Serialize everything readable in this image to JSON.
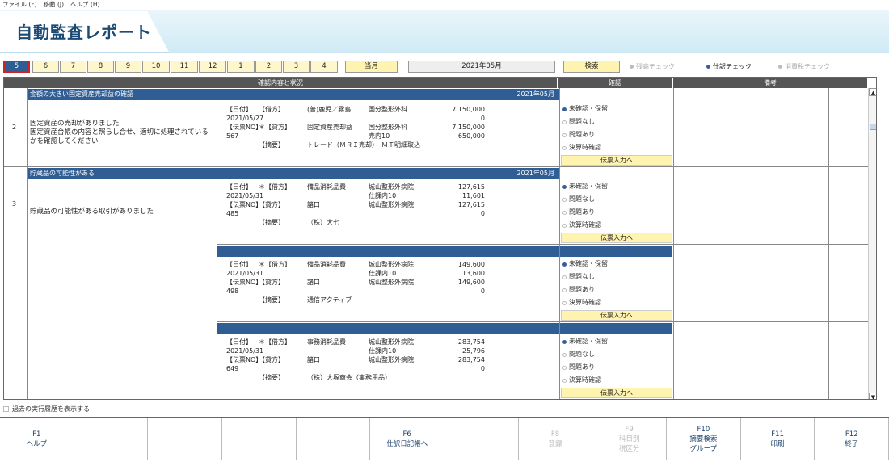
{
  "menu": [
    "ファイル (F)",
    "移動 (J)",
    "ヘルプ (H)"
  ],
  "title": "自動監査レポート",
  "months": [
    "5",
    "6",
    "7",
    "8",
    "9",
    "10",
    "11",
    "12",
    "1",
    "2",
    "3",
    "4"
  ],
  "current_month_label": "当月",
  "year_month": "2021年05月",
  "search_label": "検索",
  "radios": [
    {
      "label": "残高チェック",
      "selected": false
    },
    {
      "label": "仕訳チェック",
      "selected": true
    },
    {
      "label": "消費税チェック",
      "selected": false
    }
  ],
  "headers": {
    "content": "確認内容と状況",
    "confirm": "確認",
    "note": "備考"
  },
  "check_options": [
    "未確認・保留",
    "問題なし",
    "問題あり",
    "決算時確認"
  ],
  "slip_label": "伝票入力へ",
  "sections": [
    {
      "num": "2",
      "title": "金額の大きい固定資産売却益の確認",
      "ym": "2021年05月",
      "desc": "固定資産の売却がありました\n固定資産台帳の内容と照らし合せ、適切に処理されているかを確認してください",
      "entries": [
        {
          "lines": [
            [
              "【日付】",
              "【借方】",
              "(普)鹿児／霧島",
              "国分整形外科",
              "7,150,000"
            ],
            [
              "2021/05/27",
              "",
              "",
              "",
              "0"
            ],
            [
              "【伝票NO】",
              "＊【貸方】",
              "固定資産売却益",
              "国分整形外科",
              "7,150,000"
            ],
            [
              "567",
              "",
              "",
              "売内10",
              "650,000"
            ],
            [
              "",
              "【摘要】",
              "トレード（ＭＲＩ売却）　ＭＴ明細取込",
              "",
              ""
            ]
          ]
        }
      ]
    },
    {
      "num": "3",
      "title": "貯蔵品の可能性がある",
      "ym": "2021年05月",
      "desc": "貯蔵品の可能性がある取引がありました",
      "entries": [
        {
          "lines": [
            [
              "【日付】",
              "＊【借方】",
              "備品消耗品費",
              "城山整形外病院",
              "127,615"
            ],
            [
              "2021/05/31",
              "",
              "",
              "仕課内10",
              "11,601"
            ],
            [
              "【伝票NO】",
              "【貸方】",
              "諸口",
              "城山整形外病院",
              "127,615"
            ],
            [
              "485",
              "",
              "",
              "",
              "0"
            ],
            [
              "",
              "【摘要】",
              "（株）大七",
              "",
              ""
            ]
          ]
        },
        {
          "lines": [
            [
              "【日付】",
              "＊【借方】",
              "備品消耗品費",
              "城山整形外病院",
              "149,600"
            ],
            [
              "2021/05/31",
              "",
              "",
              "仕課内10",
              "13,600"
            ],
            [
              "【伝票NO】",
              "【貸方】",
              "諸口",
              "城山整形外病院",
              "149,600"
            ],
            [
              "498",
              "",
              "",
              "",
              "0"
            ],
            [
              "",
              "【摘要】",
              "通信アクティブ",
              "",
              ""
            ]
          ]
        },
        {
          "lines": [
            [
              "【日付】",
              "＊【借方】",
              "事務消耗品費",
              "城山整形外病院",
              "283,754"
            ],
            [
              "2021/05/31",
              "",
              "",
              "仕課内10",
              "25,796"
            ],
            [
              "【伝票NO】",
              "【貸方】",
              "諸口",
              "城山整形外病院",
              "283,754"
            ],
            [
              "649",
              "",
              "",
              "",
              "0"
            ],
            [
              "",
              "【摘要】",
              "（株）大塚商会（事務用品）",
              "",
              ""
            ]
          ]
        }
      ]
    }
  ],
  "history_label": "過去の実行履歴を表示する",
  "fkeys": [
    {
      "key": "F1",
      "label": "ヘルプ",
      "enabled": true
    },
    {
      "key": "",
      "label": "",
      "enabled": true
    },
    {
      "key": "",
      "label": "",
      "enabled": true
    },
    {
      "key": "",
      "label": "",
      "enabled": true
    },
    {
      "key": "",
      "label": "",
      "enabled": true
    },
    {
      "key": "F6",
      "label": "仕訳日記帳へ",
      "enabled": true
    },
    {
      "key": "",
      "label": "",
      "enabled": true
    },
    {
      "key": "F8",
      "label": "登録",
      "enabled": false
    },
    {
      "key": "F9",
      "label": "科目別\n税区分",
      "enabled": false
    },
    {
      "key": "F10",
      "label": "摘要検索\nグループ",
      "enabled": true
    },
    {
      "key": "F11",
      "label": "印刷",
      "enabled": true
    },
    {
      "key": "F12",
      "label": "終了",
      "enabled": true
    }
  ]
}
